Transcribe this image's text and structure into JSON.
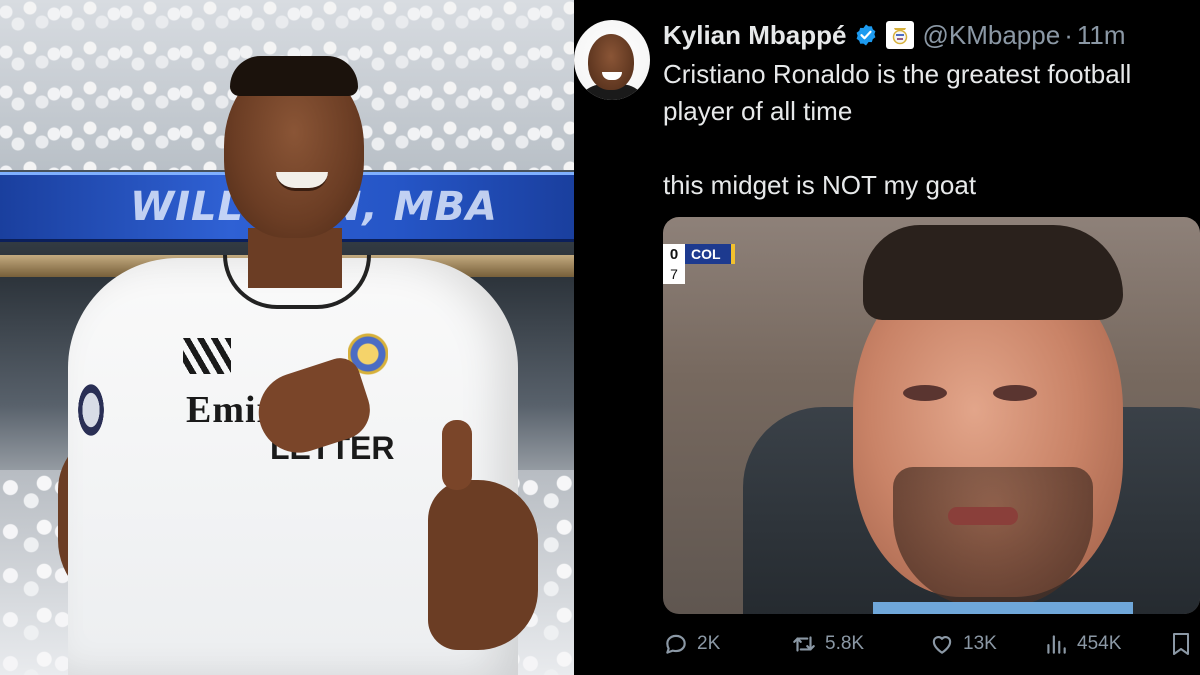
{
  "left_photo": {
    "banner_text": "WILL  MEN, MBA",
    "sponsor_line_1": "Emirates",
    "sponsor_line_2": "LETTER"
  },
  "tweet": {
    "author": {
      "display_name": "Kylian Mbappé",
      "verified": true,
      "badge_icon": "club-crest-icon",
      "handle": "@KMbappe",
      "separator": "·",
      "time": "11m"
    },
    "text_line_1": "Cristiano Ronaldo is the greatest football player of all time",
    "text_line_2": "this midget is NOT my goat",
    "media": {
      "scorebug": {
        "score": "0",
        "team": "COL",
        "minute": "7"
      }
    },
    "actions": {
      "reply_count": "2K",
      "retweet_count": "5.8K",
      "like_count": "13K",
      "views_count": "454K"
    },
    "colors": {
      "background": "#000000",
      "primary_text": "#e7e9ea",
      "secondary_text": "#8b98a5",
      "verified_blue": "#1d9bf0"
    }
  }
}
